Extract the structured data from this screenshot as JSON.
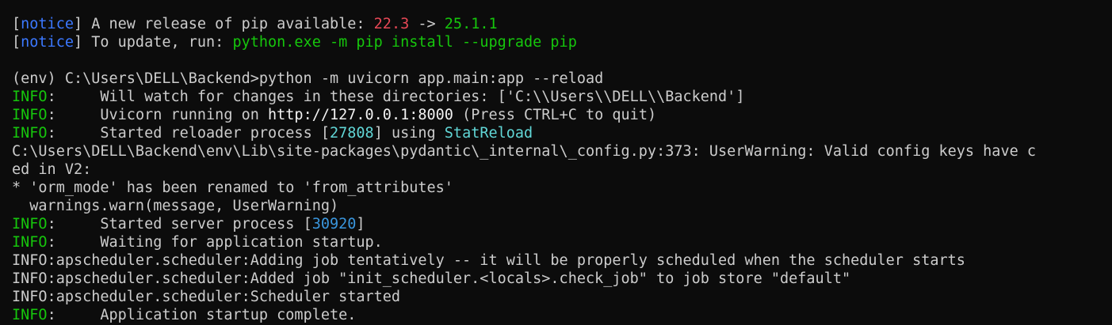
{
  "colors": {
    "background": "#0c0c0c",
    "default_text": "#cccccc",
    "notice": "#3b78ff",
    "old_version": "#e74856",
    "green": "#16c60c",
    "cyan": "#61d6d6",
    "pid_blue": "#3a96dd"
  },
  "lines": [
    [
      {
        "t": "[",
        "c": "white"
      },
      {
        "t": "notice",
        "c": "blue"
      },
      {
        "t": "] A new release of pip available: ",
        "c": "white"
      },
      {
        "t": "22.3",
        "c": "red"
      },
      {
        "t": " -> ",
        "c": "white"
      },
      {
        "t": "25.1.1",
        "c": "green"
      }
    ],
    [
      {
        "t": "[",
        "c": "white"
      },
      {
        "t": "notice",
        "c": "blue"
      },
      {
        "t": "] To update, run: ",
        "c": "white"
      },
      {
        "t": "python.exe -m pip install --upgrade pip",
        "c": "green"
      }
    ],
    [],
    [
      {
        "t": "(env) C:\\Users\\DELL\\Backend>python -m uvicorn app.main:app --reload",
        "c": "white"
      }
    ],
    [
      {
        "t": "INFO",
        "c": "green"
      },
      {
        "t": ":     Will watch for changes in these directories: ['C:\\\\Users\\\\DELL\\\\Backend']",
        "c": "white"
      }
    ],
    [
      {
        "t": "INFO",
        "c": "green"
      },
      {
        "t": ":     Uvicorn running on ",
        "c": "white"
      },
      {
        "t": "http://127.0.0.1:8000",
        "c": "brightwhite"
      },
      {
        "t": " (Press CTRL+C to quit)",
        "c": "white"
      }
    ],
    [
      {
        "t": "INFO",
        "c": "green"
      },
      {
        "t": ":     Started reloader process [",
        "c": "white"
      },
      {
        "t": "27808",
        "c": "cyan"
      },
      {
        "t": "] using ",
        "c": "white"
      },
      {
        "t": "StatReload",
        "c": "cyan"
      }
    ],
    [
      {
        "t": "C:\\Users\\DELL\\Backend\\env\\Lib\\site-packages\\pydantic\\_internal\\_config.py:373: UserWarning: Valid config keys have c",
        "c": "white"
      }
    ],
    [
      {
        "t": "ed in V2:",
        "c": "white"
      }
    ],
    [
      {
        "t": "* 'orm_mode' has been renamed to 'from_attributes'",
        "c": "white"
      }
    ],
    [
      {
        "t": "  warnings.warn(message, UserWarning)",
        "c": "white"
      }
    ],
    [
      {
        "t": "INFO",
        "c": "green"
      },
      {
        "t": ":     Started server process [",
        "c": "white"
      },
      {
        "t": "30920",
        "c": "sblue"
      },
      {
        "t": "]",
        "c": "white"
      }
    ],
    [
      {
        "t": "INFO",
        "c": "green"
      },
      {
        "t": ":     Waiting for application startup.",
        "c": "white"
      }
    ],
    [
      {
        "t": "INFO:apscheduler.scheduler:Adding job tentatively -- it will be properly scheduled when the scheduler starts",
        "c": "white"
      }
    ],
    [
      {
        "t": "INFO:apscheduler.scheduler:Added job \"init_scheduler.<locals>.check_job\" to job store \"default\"",
        "c": "white"
      }
    ],
    [
      {
        "t": "INFO:apscheduler.scheduler:Scheduler started",
        "c": "white"
      }
    ],
    [
      {
        "t": "INFO",
        "c": "green"
      },
      {
        "t": ":     Application startup complete.",
        "c": "white"
      }
    ]
  ]
}
